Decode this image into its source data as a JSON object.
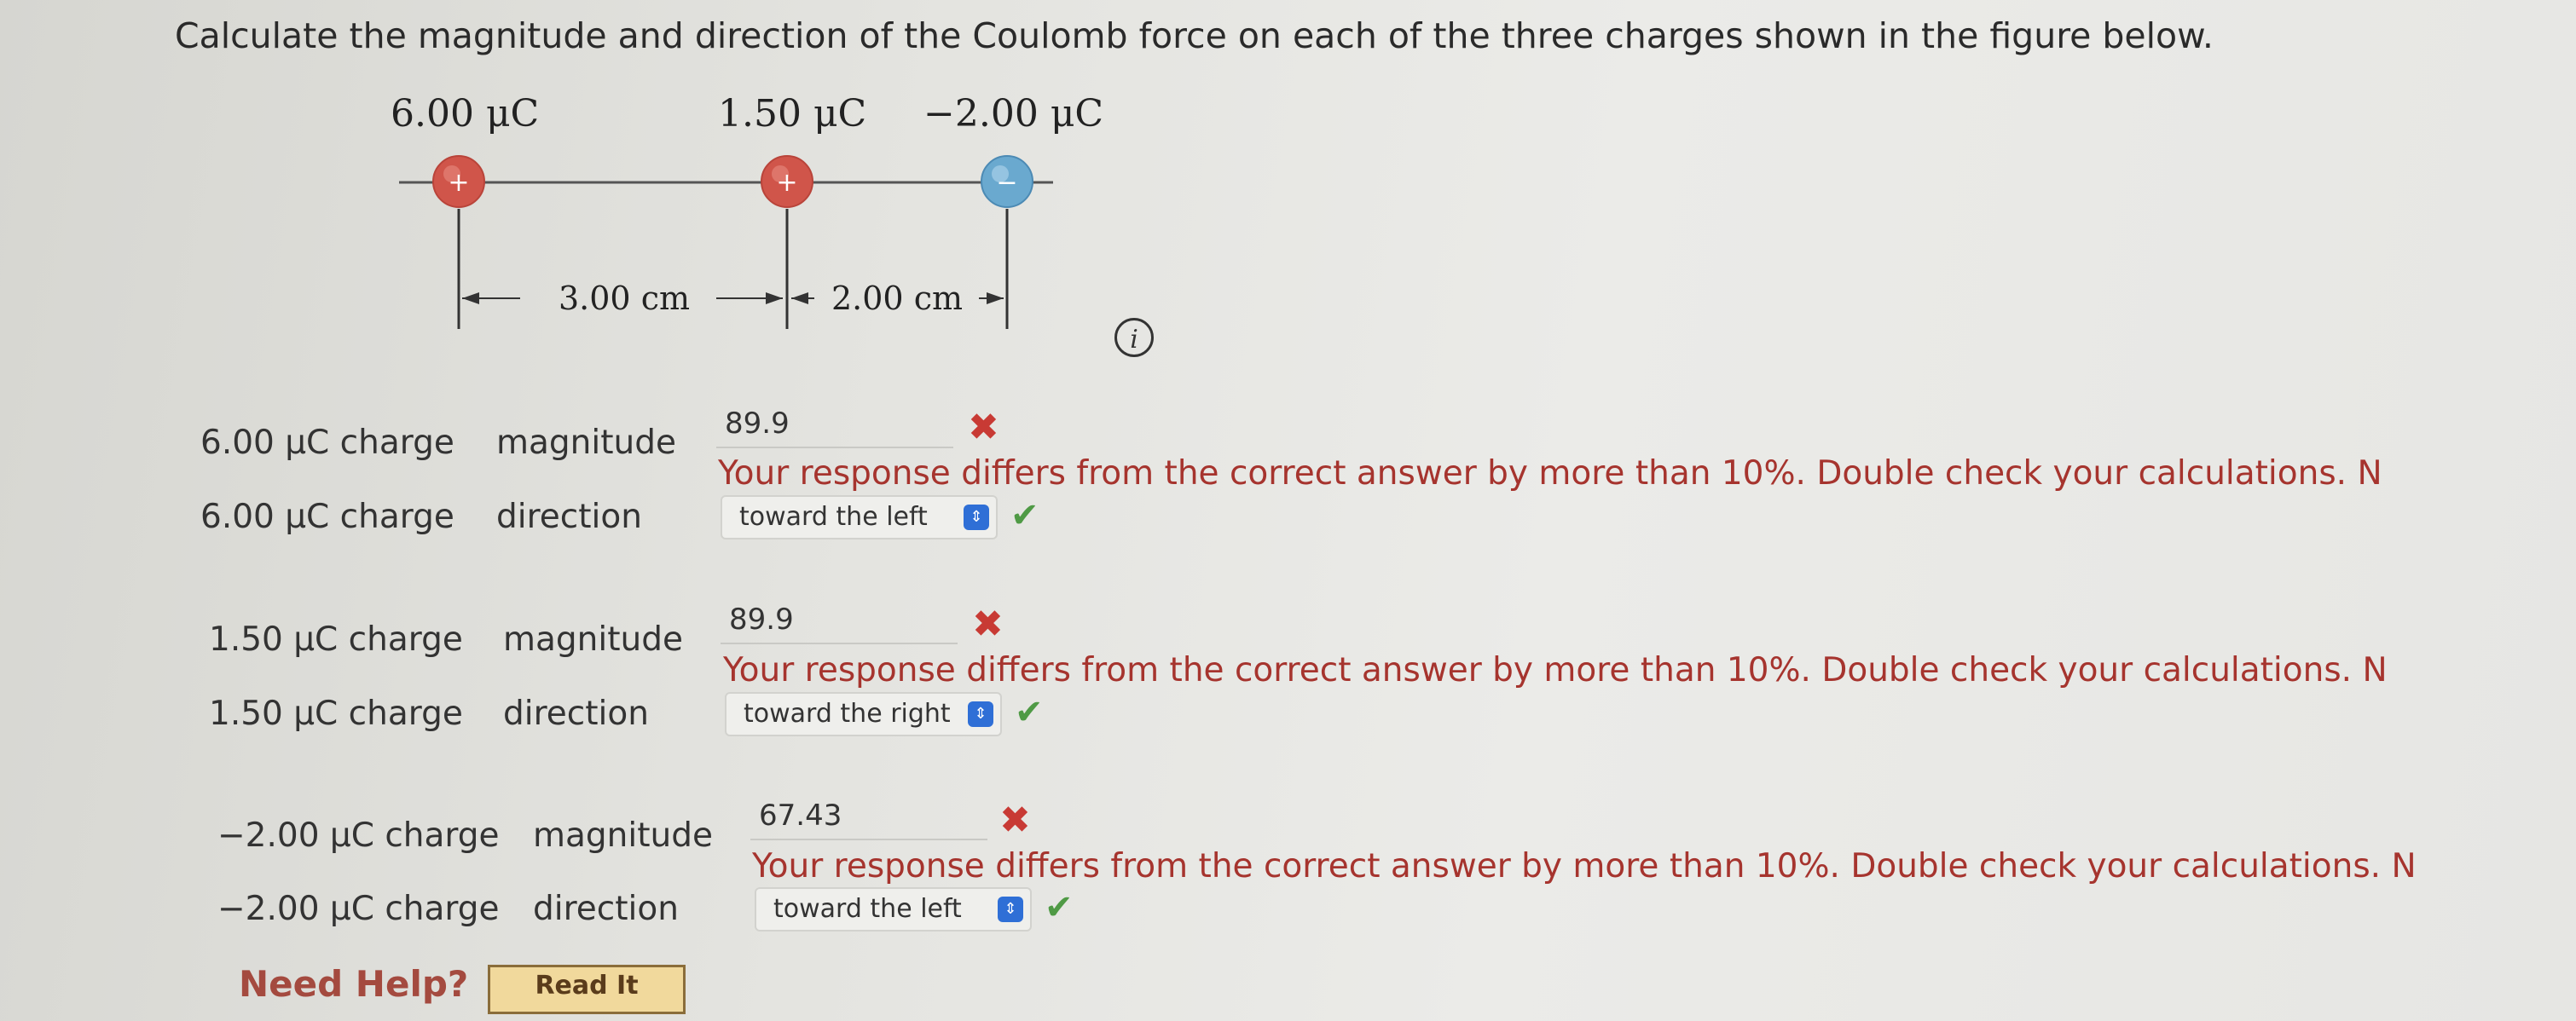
{
  "question": "Calculate the magnitude and direction of the Coulomb force on each of the three charges shown in the figure below.",
  "figure": {
    "charges": [
      {
        "label": "6.00 μC",
        "sign": "+"
      },
      {
        "label": "1.50 μC",
        "sign": "+"
      },
      {
        "label": "−2.00 μC",
        "sign": "−"
      }
    ],
    "distances": [
      "3.00 cm",
      "2.00 cm"
    ],
    "colors": {
      "positive": "#d0554a",
      "negative": "#6aa9cf"
    }
  },
  "rows": [
    {
      "magnitude_label": "6.00 μC charge",
      "magnitude_word": "magnitude",
      "magnitude_value": "89.9",
      "feedback": "Your response differs from the correct answer by more than 10%. Double check your calculations. N",
      "direction_label": "6.00 μC charge",
      "direction_word": "direction",
      "direction_value": "toward the left"
    },
    {
      "magnitude_label": "1.50 μC charge",
      "magnitude_word": "magnitude",
      "magnitude_value": "89.9",
      "feedback": "Your response differs from the correct answer by more than 10%. Double check your calculations. N",
      "direction_label": "1.50 μC charge",
      "direction_word": "direction",
      "direction_value": "toward the right"
    },
    {
      "magnitude_label": "−2.00 μC charge",
      "magnitude_word": "magnitude",
      "magnitude_value": "67.43",
      "feedback": "Your response differs from the correct answer by more than 10%. Double check your calculations. N",
      "direction_label": "−2.00 μC charge",
      "direction_word": "direction",
      "direction_value": "toward the left"
    }
  ],
  "marks": {
    "wrong": "✖",
    "correct": "✔",
    "info": "i"
  },
  "help": {
    "need_help": "Need Help?",
    "read_it": "Read It"
  }
}
